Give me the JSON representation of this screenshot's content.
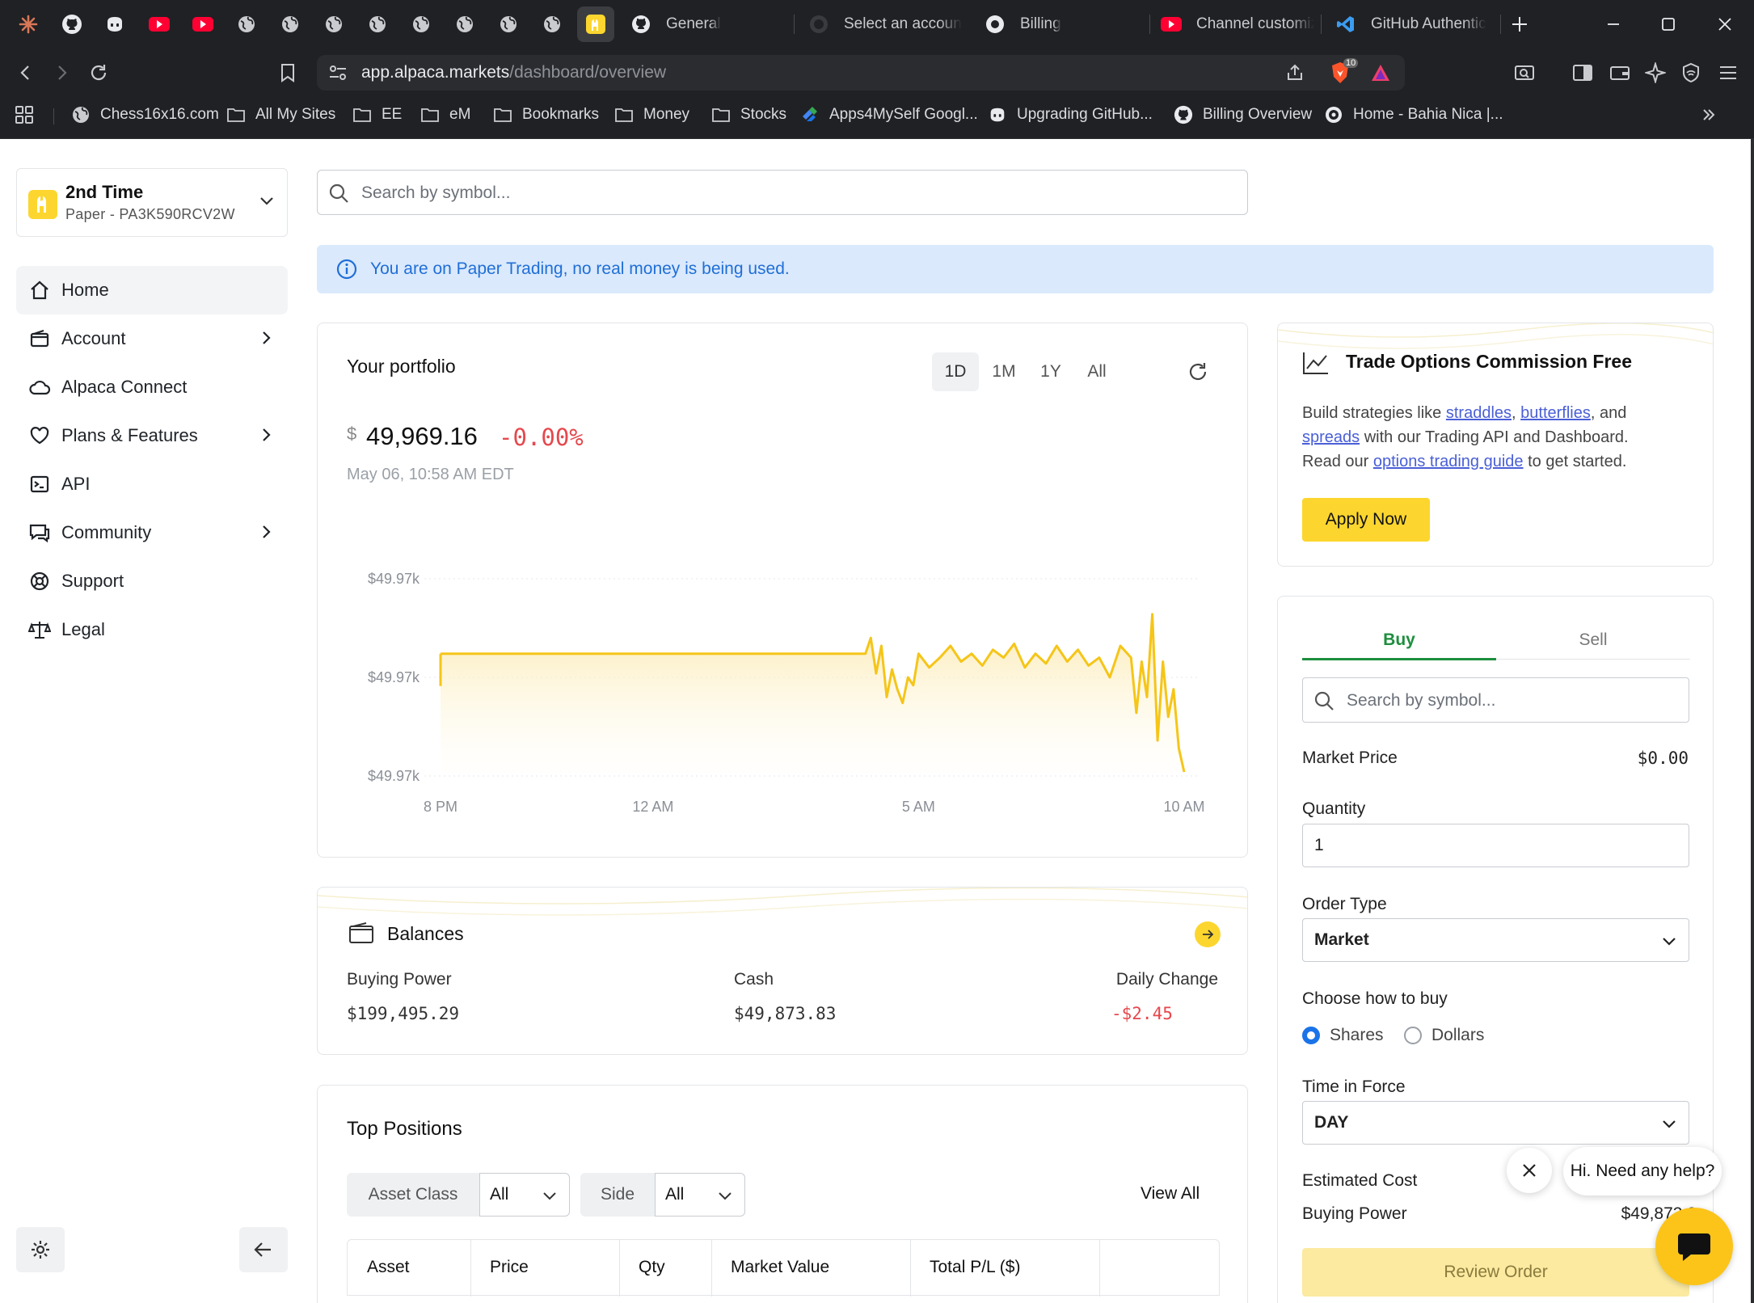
{
  "browser": {
    "pinned_tabs": [
      "claude-icon",
      "github-icon",
      "copilot-icon",
      "youtube-icon",
      "youtube-icon",
      "globe-icon",
      "globe-icon",
      "globe-icon",
      "globe-icon",
      "globe-icon",
      "globe-icon",
      "globe-icon",
      "globe-icon",
      "alpaca-icon"
    ],
    "tabs": [
      {
        "label": "General"
      },
      {
        "label": "Select an account"
      },
      {
        "label": "Billing"
      },
      {
        "label": "Channel customiz"
      },
      {
        "label": "GitHub Authentic"
      }
    ],
    "url": {
      "host": "app.alpaca.markets",
      "path": "/dashboard/overview"
    },
    "shields_count": "10",
    "bookmarks": [
      {
        "label": "Chess16x16.com",
        "icon": "globe-icon"
      },
      {
        "label": "All My Sites",
        "icon": "folder-icon"
      },
      {
        "label": "EE",
        "icon": "folder-icon"
      },
      {
        "label": "eM",
        "icon": "folder-icon"
      },
      {
        "label": "Bookmarks",
        "icon": "folder-icon"
      },
      {
        "label": "Money",
        "icon": "folder-icon"
      },
      {
        "label": "Stocks",
        "icon": "folder-icon"
      },
      {
        "label": "Apps4MySelf Googl...",
        "icon": "apps-script-icon"
      },
      {
        "label": "Upgrading GitHub...",
        "icon": "copilot-icon"
      },
      {
        "label": "Billing Overview",
        "icon": "github-icon"
      },
      {
        "label": "Home - Bahia Nica |...",
        "icon": "site-icon"
      }
    ]
  },
  "account": {
    "name": "2nd Time",
    "sub": "Paper - PA3K590RCV2W"
  },
  "nav": [
    {
      "label": "Home",
      "icon": "home-icon",
      "arrow": false
    },
    {
      "label": "Account",
      "icon": "wallet-icon",
      "arrow": true
    },
    {
      "label": "Alpaca Connect",
      "icon": "cloud-icon",
      "arrow": false
    },
    {
      "label": "Plans & Features",
      "icon": "heart-icon",
      "arrow": true
    },
    {
      "label": "API",
      "icon": "terminal-icon",
      "arrow": false
    },
    {
      "label": "Community",
      "icon": "chat-icon",
      "arrow": true
    },
    {
      "label": "Support",
      "icon": "lifebuoy-icon",
      "arrow": false
    },
    {
      "label": "Legal",
      "icon": "scale-icon",
      "arrow": false
    }
  ],
  "search": {
    "placeholder": "Search by symbol..."
  },
  "banner": {
    "text": "You are on Paper Trading, no real money is being used."
  },
  "portfolio": {
    "title": "Your portfolio",
    "ranges": [
      "1D",
      "1M",
      "1Y",
      "All"
    ],
    "selected_range": "1D",
    "currency": "$",
    "value": "49,969.16",
    "change": "-0.00%",
    "timestamp": "May 06, 10:58 AM EDT"
  },
  "chart_data": {
    "type": "area",
    "title": "",
    "xlabel": "",
    "ylabel": "",
    "x_ticks": [
      "8 PM",
      "12 AM",
      "5 AM",
      "10 AM"
    ],
    "y_ticks": [
      "$49.97k",
      "$49.97k",
      "$49.97k"
    ],
    "series": [
      {
        "color": "#f5c518",
        "x": [
          20.0,
          21.0,
          22.0,
          23.0,
          0.0,
          1.0,
          2.0,
          3.0,
          4.0,
          4.0,
          4.1,
          4.2,
          4.3,
          4.4,
          4.5,
          4.6,
          4.7,
          4.8,
          4.9,
          5.0,
          5.2,
          5.4,
          5.6,
          5.8,
          6.0,
          6.2,
          6.4,
          6.6,
          6.8,
          7.0,
          7.2,
          7.4,
          7.6,
          7.8,
          8.0,
          8.2,
          8.4,
          8.6,
          8.8,
          9.0,
          9.1,
          9.2,
          9.3,
          9.4,
          9.5,
          9.6,
          9.7,
          9.8,
          9.9,
          10.0
        ],
        "values": [
          0.62,
          0.62,
          0.62,
          0.62,
          0.62,
          0.62,
          0.62,
          0.62,
          0.62,
          0.62,
          0.7,
          0.52,
          0.66,
          0.4,
          0.54,
          0.44,
          0.37,
          0.5,
          0.46,
          0.62,
          0.55,
          0.6,
          0.66,
          0.58,
          0.62,
          0.56,
          0.64,
          0.6,
          0.67,
          0.55,
          0.62,
          0.57,
          0.66,
          0.58,
          0.64,
          0.56,
          0.6,
          0.5,
          0.66,
          0.6,
          0.32,
          0.58,
          0.4,
          0.82,
          0.18,
          0.58,
          0.3,
          0.44,
          0.14,
          0.02
        ]
      }
    ],
    "grid": true
  },
  "balances": {
    "title": "Balances",
    "items": [
      {
        "label": "Buying Power",
        "value": "$199,495.29",
        "color": "#333333"
      },
      {
        "label": "Cash",
        "value": "$49,873.83",
        "color": "#333333"
      },
      {
        "label": "Daily Change",
        "value": "-$2.45",
        "color": "#e5484d"
      }
    ]
  },
  "positions": {
    "title": "Top Positions",
    "filters": [
      {
        "label": "Asset Class",
        "value": "All"
      },
      {
        "label": "Side",
        "value": "All"
      }
    ],
    "view_all": "View All",
    "columns": [
      "Asset",
      "Price",
      "Qty",
      "Market Value",
      "Total P/L ($)",
      ""
    ]
  },
  "options_card": {
    "title": "Trade Options Commission Free",
    "line1_pre": "Build strategies like ",
    "link1": "straddles",
    "sep1": ", ",
    "link2": "butterflies",
    "line1_post": ", and",
    "link3": "spreads",
    "line2_post": " with our Trading API and Dashboard.",
    "line3_pre": "Read our ",
    "link4": "options trading guide",
    "line3_post": " to get started.",
    "button": "Apply Now"
  },
  "trade": {
    "tabs": [
      "Buy",
      "Sell"
    ],
    "active_tab": "Buy",
    "search_placeholder": "Search by symbol...",
    "market_price_label": "Market Price",
    "market_price": "$0.00",
    "quantity_label": "Quantity",
    "quantity": "1",
    "order_type_label": "Order Type",
    "order_type": "Market",
    "how_to_buy_label": "Choose how to buy",
    "how_options": [
      "Shares",
      "Dollars"
    ],
    "how_selected": "Shares",
    "tif_label": "Time in Force",
    "tif": "DAY",
    "estimated_cost_label": "Estimated Cost",
    "buying_power_label": "Buying Power",
    "buying_power": "$49,873.8",
    "review_button": "Review Order"
  },
  "help": {
    "text": "Hi. Need any help?"
  },
  "colors": {
    "accent": "#fcd62e",
    "chart_line": "#f5c518",
    "negative": "#e5484d",
    "buy": "#1e8e3e",
    "info": "#1f6fd6"
  }
}
